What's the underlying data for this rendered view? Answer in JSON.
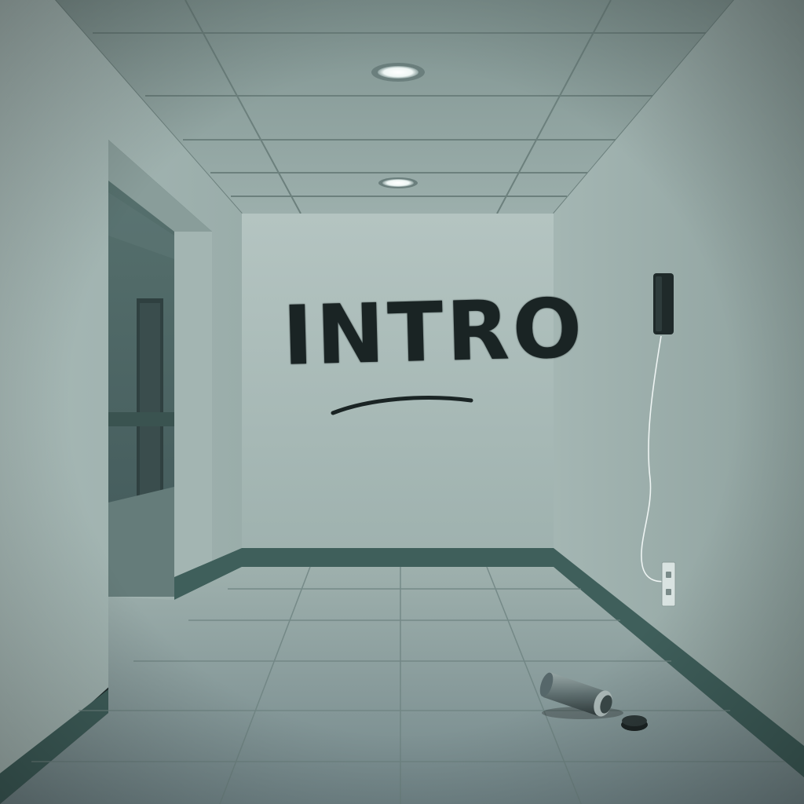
{
  "scene": {
    "wall_text": "INTRO"
  },
  "palette": {
    "wall_back": "#a9bbb8",
    "wall_left": "#94a8a5",
    "wall_right": "#8fa3a0",
    "ceiling": "#8ea2a0",
    "floor": "#7d918f",
    "baseboard": "#3f5f5b",
    "paint": "#1a2424"
  },
  "icons": {
    "ceiling_light": "round-recessed-light",
    "wall_device": "wall-mounted-phone",
    "outlet": "power-outlet",
    "spray_can": "spray-paint-can",
    "can_cap": "spray-can-cap"
  }
}
